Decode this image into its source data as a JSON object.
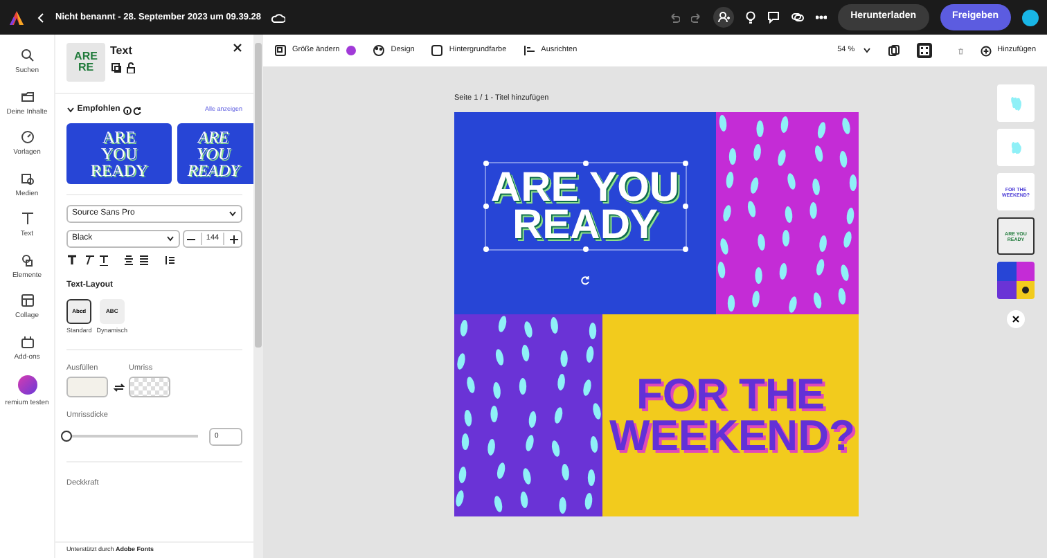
{
  "header": {
    "title": "Nicht benannt - 28. September 2023 um 09.39.28",
    "download": "Herunterladen",
    "share": "Freigeben"
  },
  "rail": [
    {
      "label": "Suchen"
    },
    {
      "label": "Deine Inhalte"
    },
    {
      "label": "Vorlagen"
    },
    {
      "label": "Medien"
    },
    {
      "label": "Text"
    },
    {
      "label": "Elemente"
    },
    {
      "label": "Collage"
    },
    {
      "label": "Add-ons"
    },
    {
      "label": "remium testen"
    }
  ],
  "panel": {
    "thumb_text": "ARE RE",
    "title": "Text",
    "section": "Empfohlen",
    "show_all": "Alle anzeigen",
    "presets": [
      {
        "text": "ARE YOU READY",
        "italic": false
      },
      {
        "text": "ARE YOU READY",
        "italic": true
      }
    ],
    "font": "Source Sans Pro",
    "weight": "Black",
    "size": "144",
    "layout_title": "Text-Layout",
    "layouts": [
      {
        "glyph": "Abcd",
        "label": "Standard",
        "selected": true
      },
      {
        "glyph": "ABC",
        "label": "Dynamisch",
        "selected": false
      }
    ],
    "fill_label": "Ausfüllen",
    "outline_label": "Umriss",
    "thickness_label": "Umrissdicke",
    "thickness": {
      "level": 0,
      "value": "0"
    },
    "opacity_label": "Deckkraft",
    "footer": "Unterstützt durch **Adobe Fonts**"
  },
  "toolbar": {
    "items": [
      "Größe ändern",
      "Design",
      "Hintergrundfarbe",
      "Ausrichten"
    ],
    "zoom": "54 %",
    "add": "Hinzufügen"
  },
  "canvas": {
    "page_label": "Seite 1 / 1 - Titel hinzufügen",
    "headline": "ARE YOU READY",
    "subline": "FOR THE WEEKEND?"
  },
  "layers": [
    {
      "kind": "drops",
      "selected": false
    },
    {
      "kind": "drops",
      "selected": false
    },
    {
      "kind": "text",
      "text": "FOR THE WEEKEND?",
      "selected": false
    },
    {
      "kind": "text",
      "text": "ARE YOU READY",
      "selected": true
    },
    {
      "kind": "background",
      "selected": false
    }
  ]
}
